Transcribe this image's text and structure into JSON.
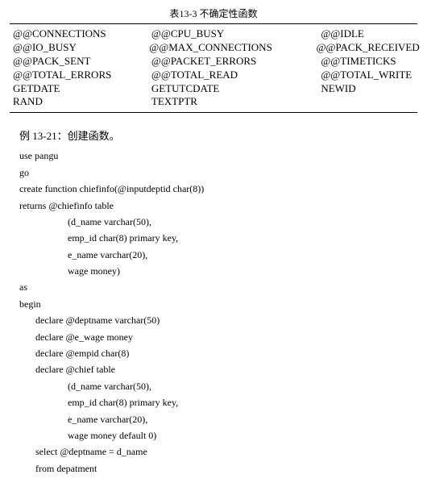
{
  "table": {
    "title": "表13-3  不确定性函数",
    "rows": [
      [
        "@@CONNECTIONS",
        "@@CPU_BUSY",
        "@@IDLE"
      ],
      [
        "@@IO_BUSY",
        "@@MAX_CONNECTIONS",
        "@@PACK_RECEIVED"
      ],
      [
        "@@PACK_SENT",
        "@@PACKET_ERRORS",
        "@@TIMETICKS"
      ],
      [
        "@@TOTAL_ERRORS",
        "@@TOTAL_READ",
        "@@TOTAL_WRITE"
      ],
      [
        "GETDATE",
        "GETUTCDATE",
        "NEWID"
      ],
      [
        "RAND",
        "TEXTPTR",
        ""
      ]
    ]
  },
  "example": {
    "title": "例 13-21：创建函数。",
    "lines": [
      {
        "t": "use pangu",
        "c": ""
      },
      {
        "t": "go",
        "c": ""
      },
      {
        "t": "create function chiefinfo(@inputdeptid char(8))",
        "c": ""
      },
      {
        "t": "returns @chiefinfo table",
        "c": ""
      },
      {
        "t": "(d_name varchar(50),",
        "c": "ind2"
      },
      {
        "t": "emp_id char(8) primary key,",
        "c": "ind2"
      },
      {
        "t": "e_name varchar(20),",
        "c": "ind2"
      },
      {
        "t": "wage money)",
        "c": "ind2"
      },
      {
        "t": "as",
        "c": ""
      },
      {
        "t": "begin",
        "c": ""
      },
      {
        "t": "declare @deptname varchar(50)",
        "c": "ind1"
      },
      {
        "t": "declare @e_wage money",
        "c": "ind1"
      },
      {
        "t": "declare @empid char(8)",
        "c": "ind1"
      },
      {
        "t": "declare @chief table",
        "c": "ind1"
      },
      {
        "t": "(d_name varchar(50),",
        "c": "ind2"
      },
      {
        "t": "emp_id char(8) primary key,",
        "c": "ind2"
      },
      {
        "t": "e_name varchar(20),",
        "c": "ind2"
      },
      {
        "t": "wage money default 0)",
        "c": "ind2"
      },
      {
        "t": "select @deptname = d_name",
        "c": "ind1"
      },
      {
        "t": "from depatment",
        "c": "ind1"
      }
    ]
  }
}
